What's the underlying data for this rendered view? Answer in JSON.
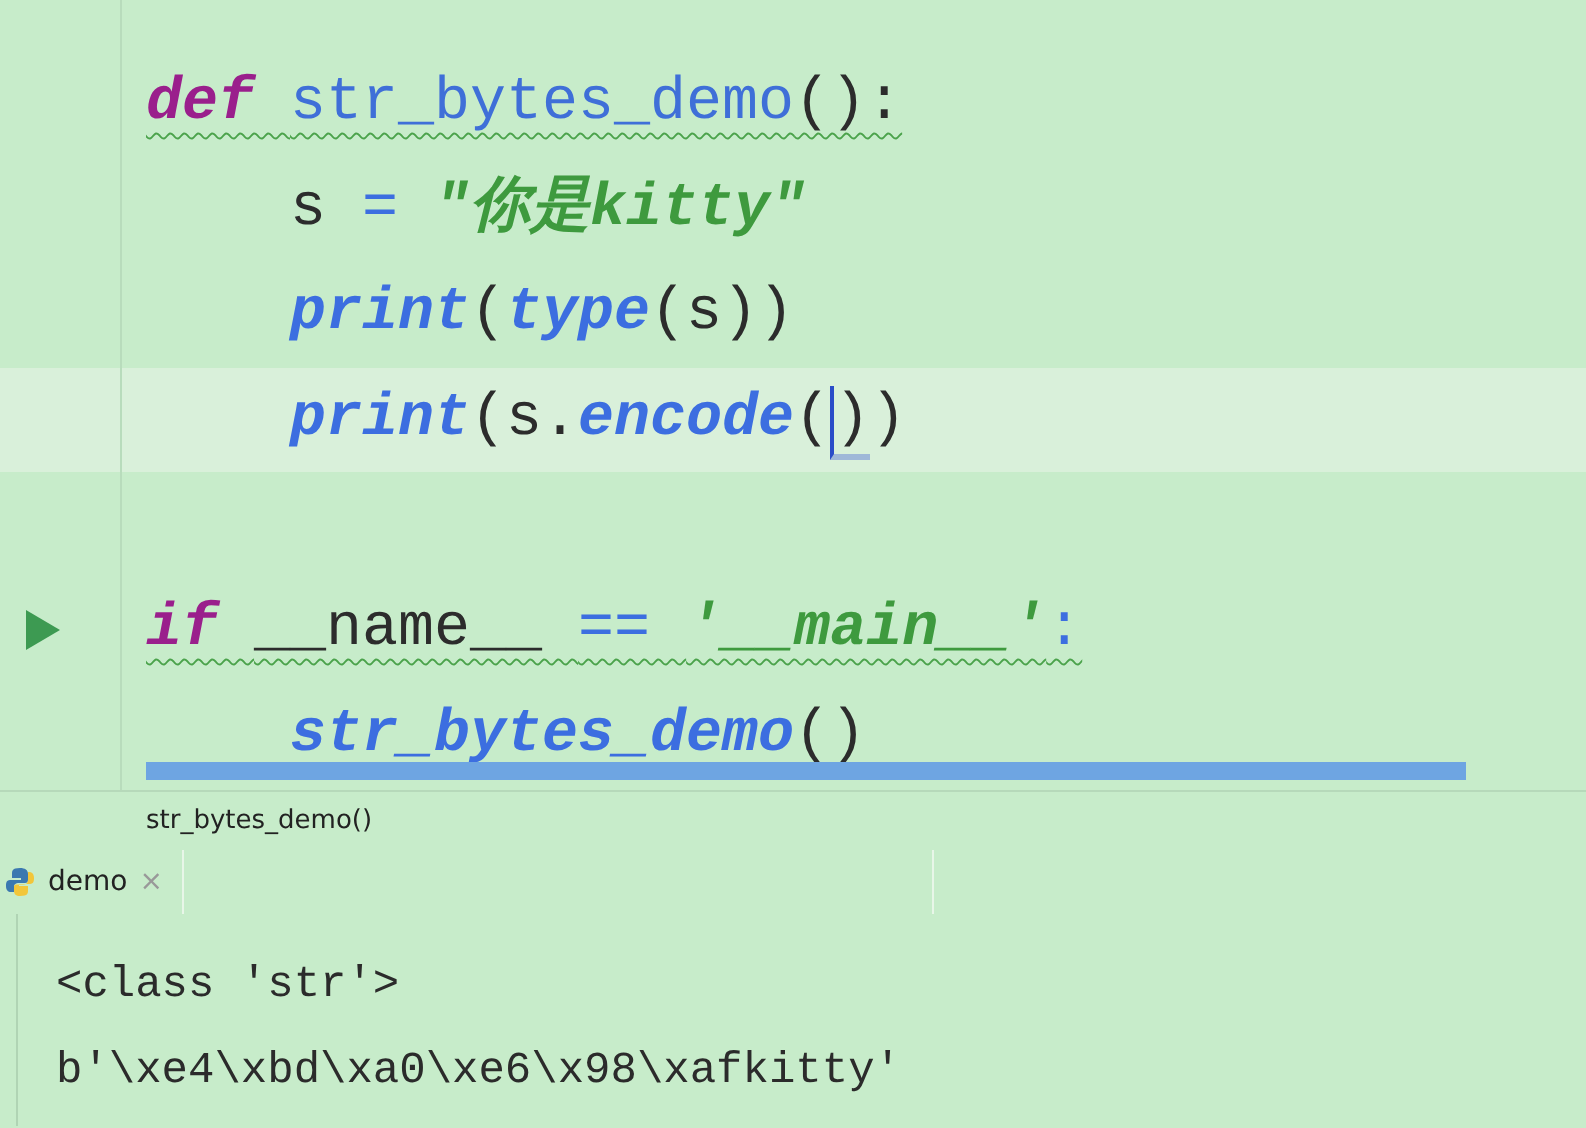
{
  "editor": {
    "lines": [
      {
        "kind": "code",
        "warning": true,
        "tokens": [
          {
            "text": "def ",
            "kind": "keyword"
          },
          {
            "text": "str_bytes_demo",
            "kind": "defname"
          },
          {
            "text": "():",
            "kind": "plain"
          }
        ],
        "children": [
          {
            "kind": "code",
            "tokens": [
              {
                "text": "s ",
                "kind": "plain"
              },
              {
                "text": "= ",
                "kind": "op"
              },
              {
                "text": "\"你是kitty\"",
                "kind": "string"
              }
            ]
          },
          {
            "kind": "code",
            "tokens": [
              {
                "text": "print",
                "kind": "call"
              },
              {
                "text": "(",
                "kind": "plain"
              },
              {
                "text": "type",
                "kind": "call"
              },
              {
                "text": "(s))",
                "kind": "plain"
              }
            ]
          },
          {
            "kind": "code",
            "current": true,
            "tokens": [
              {
                "text": "print",
                "kind": "call"
              },
              {
                "text": "(s.",
                "kind": "plain"
              },
              {
                "text": "encode",
                "kind": "call"
              },
              {
                "text": "(",
                "kind": "plain"
              },
              {
                "text": ")",
                "kind": "plain",
                "caret": true
              },
              {
                "text": ")",
                "kind": "plain"
              }
            ]
          }
        ]
      },
      {
        "kind": "blank"
      },
      {
        "kind": "code",
        "run_marker": true,
        "warning": true,
        "tokens": [
          {
            "text": "if ",
            "kind": "keyword"
          },
          {
            "text": "__name__ ",
            "kind": "plain"
          },
          {
            "text": "== ",
            "kind": "op"
          },
          {
            "text": "'__main__'",
            "kind": "string"
          },
          {
            "text": ":",
            "kind": "op"
          }
        ],
        "children": [
          {
            "kind": "code",
            "tokens": [
              {
                "text": "str_bytes_demo",
                "kind": "call"
              },
              {
                "text": "()",
                "kind": "plain"
              }
            ]
          }
        ]
      }
    ]
  },
  "breadcrumb": "str_bytes_demo()",
  "tabs": [
    {
      "label": "demo",
      "selected": true,
      "close": "×"
    }
  ],
  "console": {
    "lines": [
      "<class 'str'>",
      "b'\\xe4\\xbd\\xa0\\xe6\\x98\\xafkitty'"
    ]
  }
}
